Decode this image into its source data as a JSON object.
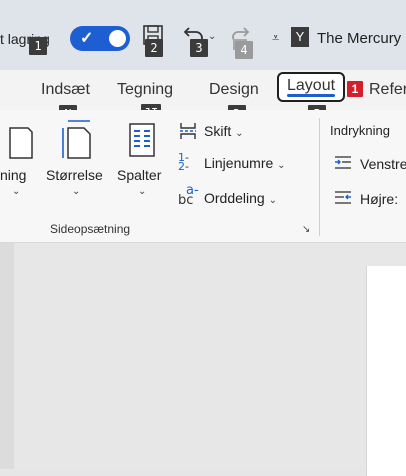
{
  "titlebar": {
    "autosave_label": "t lagring",
    "toggle_on": true,
    "doc_title": "The Mercury",
    "profile_badge": "Y",
    "qat_icons": [
      "save-icon",
      "undo-icon",
      "redo-icon",
      "customize-qat-icon"
    ]
  },
  "keytips": {
    "autosave": "1",
    "save": "2",
    "undo": "3",
    "redo": "4",
    "insert": "N",
    "draw": "JI",
    "design": "D",
    "layout": "P",
    "layout_badge": "1"
  },
  "tabs": [
    {
      "label": "Indsæt",
      "active": false
    },
    {
      "label": "Tegning",
      "active": false
    },
    {
      "label": "Design",
      "active": false
    },
    {
      "label": "Layout",
      "active": true
    },
    {
      "label": "Refer",
      "active": false
    }
  ],
  "ribbon": {
    "margins_label": "ning",
    "size_label": "Størrelse",
    "columns_label": "Spalter",
    "breaks_label": "Skift",
    "line_numbers_label": "Linjenumre",
    "hyphenation_label": "Orddeling",
    "group_label": "Sideopsætning",
    "indent_label": "Indrykning",
    "indent_left_label": "Venstre",
    "indent_right_label": "Højre:"
  },
  "colors": {
    "accent": "#1d5fd3",
    "keytip_bg": "#3b3b3b",
    "badge_red": "#d21f2b"
  }
}
